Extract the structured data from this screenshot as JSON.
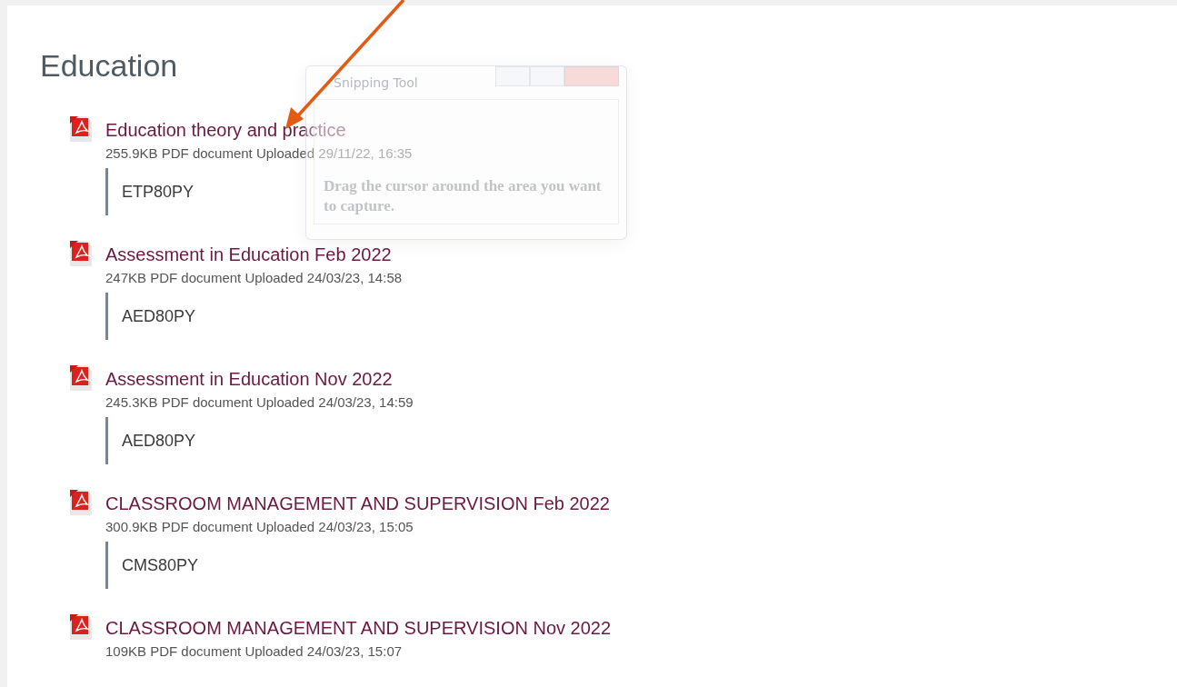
{
  "heading": "Education",
  "files": [
    {
      "title": "Education theory and practice",
      "meta": "255.9KB PDF document Uploaded 29/11/22, 16:35",
      "code": "ETP80PY"
    },
    {
      "title": "Assessment in Education Feb 2022",
      "meta": "247KB PDF document Uploaded 24/03/23, 14:58",
      "code": "AED80PY"
    },
    {
      "title": "Assessment in Education Nov 2022",
      "meta": "245.3KB PDF document Uploaded 24/03/23, 14:59",
      "code": "AED80PY"
    },
    {
      "title": "CLASSROOM MANAGEMENT AND SUPERVISION Feb 2022",
      "meta": "300.9KB PDF document Uploaded 24/03/23, 15:05",
      "code": "CMS80PY"
    },
    {
      "title": "CLASSROOM MANAGEMENT AND SUPERVISION Nov 2022",
      "meta": "109KB PDF document Uploaded 24/03/23, 15:07"
    }
  ],
  "snipping_tool": {
    "title": "Snipping Tool",
    "message": "Drag the cursor around the area you want to capture."
  }
}
